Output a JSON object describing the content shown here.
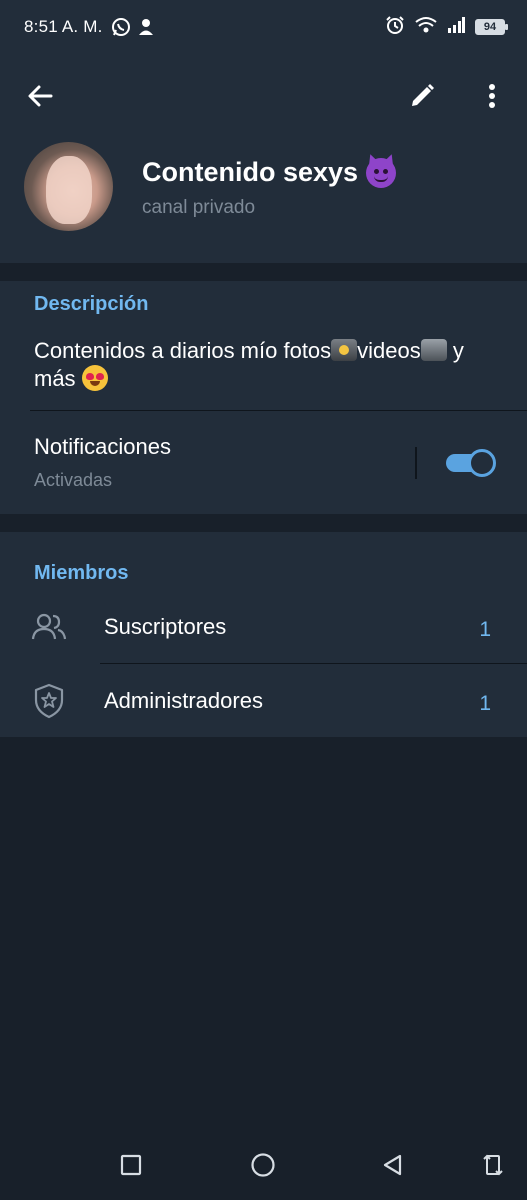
{
  "status_bar": {
    "time": "8:51 A. M.",
    "battery": "94",
    "icons": [
      "whatsapp-icon",
      "person-add-icon",
      "alarm-icon",
      "wifi-icon",
      "signal-icon",
      "battery-icon"
    ]
  },
  "header": {
    "back_icon": "arrow-left-icon",
    "edit_icon": "pencil-icon",
    "more_icon": "more-vertical-icon",
    "channel_name": "Contenido sexys",
    "channel_type": "canal privado"
  },
  "description": {
    "title": "Descripción",
    "text_part1": "Contenidos a diarios mío fotos",
    "text_part2": "videos",
    "text_part3": " y más "
  },
  "notifications": {
    "label": "Notificaciones",
    "status": "Activadas",
    "enabled": true
  },
  "members": {
    "title": "Miembros",
    "items": [
      {
        "label": "Suscriptores",
        "count": "1",
        "icon": "people-icon"
      },
      {
        "label": "Administradores",
        "count": "1",
        "icon": "shield-star-icon"
      }
    ]
  },
  "colors": {
    "background": "#18202a",
    "surface": "#222d3a",
    "accent": "#71b8f0",
    "secondary_text": "#7e8a97"
  }
}
